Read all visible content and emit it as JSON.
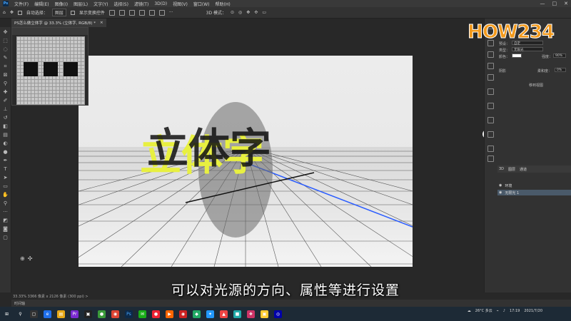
{
  "menubar": {
    "logo": "Ps",
    "items": [
      "文件(F)",
      "编辑(E)",
      "图像(I)",
      "图层(L)",
      "文字(Y)",
      "选择(S)",
      "滤镜(T)",
      "3D(D)",
      "视图(V)",
      "窗口(W)",
      "帮助(H)"
    ],
    "min": "—",
    "max": "□",
    "close": "✕"
  },
  "optionsbar": {
    "auto_select_label": "自动选择：",
    "auto_select_value": "图层",
    "show_transform": "显示变换控件",
    "mode_3d": "3D 模式："
  },
  "document_tab": {
    "title": "PS怎么做立体字 @ 33.3% (立体字, RGB/8) *",
    "close": "×"
  },
  "canvas": {
    "text_3d": "立体字"
  },
  "status": {
    "text": "33.33%    3366 像素 x 2126 像素 (300 ppi)   >"
  },
  "timeline": {
    "label": "时间轴"
  },
  "subtitle": "可以对光源的方向、属性等进行设置",
  "logo_text": "HOW234",
  "properties_panel": {
    "preset_label": "预设：",
    "preset_value": "自定",
    "type_label": "类型：",
    "type_value": "无限光",
    "color_label": "颜色：",
    "intensity_label": "强度：",
    "intensity_value": "90%",
    "shadow_label": "阴影",
    "softness_label": "柔和度：",
    "softness_value": "0%",
    "move_to_view": "移到视图"
  },
  "layers_panel": {
    "tabs": [
      "3D",
      "图层",
      "通道"
    ],
    "rows": [
      {
        "label": "环境"
      },
      {
        "label": "无限光 1"
      }
    ]
  },
  "taskbar": {
    "weather": "26°C 多云",
    "time": "17:19",
    "date": "2021/7/20"
  },
  "colors": {
    "accent_blue": "#2a5cff",
    "text_yellow": "#e8f040",
    "logo_orange": "#f39a1c"
  }
}
